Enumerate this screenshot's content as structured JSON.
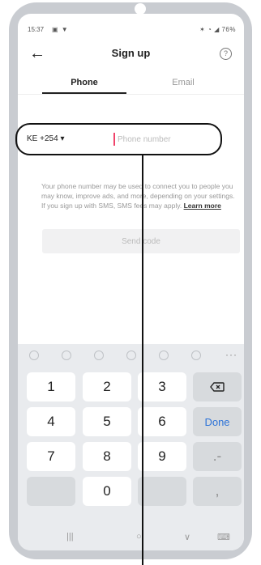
{
  "status_bar": {
    "time": "15:37",
    "left_icons": "▣ ▼",
    "right_icons": "✶ ◔ ◢ ",
    "battery": "76%"
  },
  "header": {
    "title": "Sign up",
    "help_label": "?"
  },
  "tabs": [
    {
      "label": "Phone",
      "active": true
    },
    {
      "label": "Email",
      "active": false
    }
  ],
  "phone_entry": {
    "country_code": "KE +254",
    "dropdown_caret": "▾",
    "placeholder": "Phone number",
    "value": ""
  },
  "disclaimer": {
    "text": "Your phone number may be used to connect you to people you may know, improve ads, and more, depending on your settings. If you sign up with SMS, SMS fees may apply. ",
    "link": "Learn more"
  },
  "send_button": {
    "label": "Send code"
  },
  "keyboard": {
    "keys": [
      {
        "label": "1"
      },
      {
        "label": "2"
      },
      {
        "label": "3"
      },
      {
        "label": "⌫",
        "kind": "backspace"
      },
      {
        "label": "4"
      },
      {
        "label": "5"
      },
      {
        "label": "6"
      },
      {
        "label": "Done",
        "kind": "done"
      },
      {
        "label": "7"
      },
      {
        "label": "8"
      },
      {
        "label": "9"
      },
      {
        "label": ".-",
        "kind": "symbol"
      },
      {
        "label": "",
        "kind": "blank"
      },
      {
        "label": "0"
      },
      {
        "label": "",
        "kind": "blank"
      },
      {
        "label": ",",
        "kind": "symbol"
      }
    ],
    "toolbar_more": "···"
  },
  "nav_bar": {
    "recents": "|||",
    "home": "○",
    "back": "∨",
    "keyboard": "⌨"
  },
  "colors": {
    "accent": "#f0436a",
    "done_blue": "#2d73d8",
    "frame": "#c9ccd1"
  }
}
